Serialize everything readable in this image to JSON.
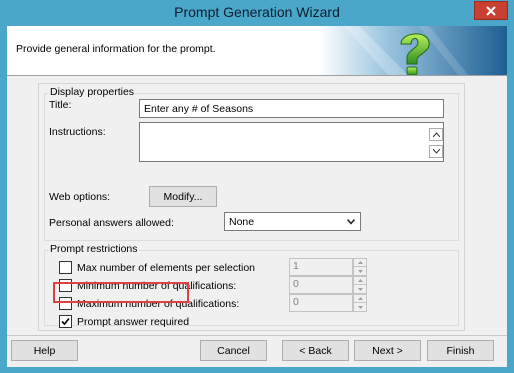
{
  "window": {
    "title": "Prompt Generation Wizard"
  },
  "header": {
    "text": "Provide general information for the prompt."
  },
  "display_properties": {
    "group_label": "Display properties",
    "title_label": "Title:",
    "title_value": "Enter any # of Seasons",
    "instructions_label": "Instructions:",
    "instructions_value": "",
    "web_options_label": "Web options:",
    "modify_label": "Modify...",
    "personal_answers_label": "Personal answers allowed:",
    "personal_answers_value": "None"
  },
  "restrictions": {
    "group_label": "Prompt restrictions",
    "items": [
      {
        "label": "Max number of elements per selection",
        "value": "1",
        "checked": false
      },
      {
        "label": "Minimum number of qualifications:",
        "value": "0",
        "checked": false
      },
      {
        "label": "Maximum number of qualifications:",
        "value": "0",
        "checked": false
      }
    ],
    "answer_required_label": "Prompt answer required",
    "answer_required_checked": true
  },
  "buttons": {
    "help": "Help",
    "cancel": "Cancel",
    "back": "< Back",
    "next": "Next >",
    "finish": "Finish"
  },
  "colors": {
    "titlebar": "#4aa7c9",
    "close": "#c84031",
    "highlight": "#e04040"
  }
}
